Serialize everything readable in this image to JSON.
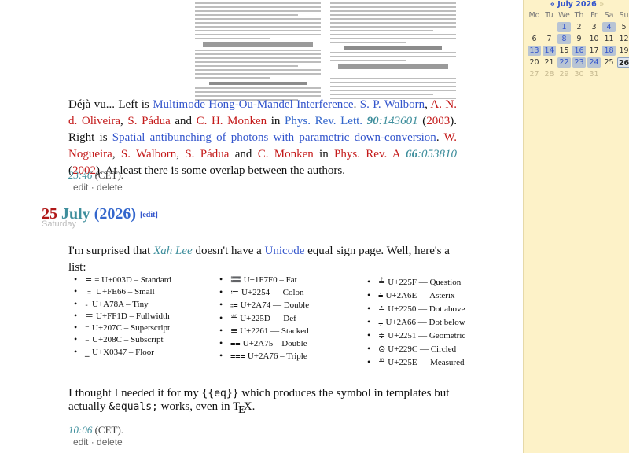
{
  "entry1": {
    "text_deja": "Déjà vu... Left is",
    "paper1_title": "Multimode Hong-Ou-Mandel Interference",
    "paper1_authors": [
      "S. P. Walborn",
      "A. N. d. Oliveira",
      "S. Pádua",
      "C. H. Monken"
    ],
    "paper1_journal": "Phys. Rev. Lett.",
    "paper1_volume": "90",
    "paper1_pages": "143601",
    "paper1_year": "2003",
    "text_right": "Right is",
    "paper2_title": "Spatial antibunching of photons with parametric down-conversion",
    "paper2_authors": [
      "W. Nogueira",
      "S. Walborn",
      "S. Pádua",
      "C. Monken"
    ],
    "paper2_journal": "Phys. Rev. A",
    "paper2_volume": "66",
    "paper2_pages": "053810",
    "paper2_year": "2002",
    "text_overlap": "At least there is some overlap between the authors.",
    "time": "23:46",
    "tz": "(CET).",
    "edit_label": "edit",
    "delete_label": "delete"
  },
  "day": {
    "number": "25",
    "month": "July",
    "year": "(2026)",
    "edit_link": "[edit]",
    "weekday": "Saturday"
  },
  "entry2": {
    "intro_pre": "I'm surprised that",
    "person": "Xah Lee",
    "intro_mid": "doesn't have a",
    "unicode_link": "Unicode",
    "intro_post": "equal sign page. Well, here's a list:",
    "col1": [
      {
        "sym": "=",
        "text": "= U+003D – Standard"
      },
      {
        "sym": "﹦",
        "text": "U+FE66 – Small"
      },
      {
        "sym": "꞊",
        "text": "U+A78A – Tiny"
      },
      {
        "sym": "＝",
        "text": "U+FF1D – Fullwidth"
      },
      {
        "sym": "⁼",
        "text": "U+207C – Superscript"
      },
      {
        "sym": "₌",
        "text": "U+208C – Subscript"
      },
      {
        "sym": "_",
        "text": "U+X0347 – Floor"
      }
    ],
    "col2": [
      {
        "sym": "🟰",
        "text": "U+1F7F0 – Fat"
      },
      {
        "sym": "≔",
        "text": "U+2254 — Colon"
      },
      {
        "sym": "⩴",
        "text": "U+2A74 — Double"
      },
      {
        "sym": "≝",
        "text": "U+225D — Def"
      },
      {
        "sym": "≡",
        "text": "U+2261 — Stacked"
      },
      {
        "sym": "⩵",
        "text": "U+2A75 – Double"
      },
      {
        "sym": "⩶",
        "text": "U+2A76 – Triple"
      }
    ],
    "col3": [
      {
        "sym": "≟",
        "text": "U+225F — Question"
      },
      {
        "sym": "⩮",
        "text": "U+2A6E — Asterix"
      },
      {
        "sym": "≐",
        "text": "U+2250 — Dot above"
      },
      {
        "sym": "⩦",
        "text": "U+2A66 — Dot below"
      },
      {
        "sym": "≑",
        "text": "U+2251 — Geometric"
      },
      {
        "sym": "⊜",
        "text": "U+229C — Circled"
      },
      {
        "sym": "≞",
        "text": "U+225E — Measured"
      }
    ],
    "outro_pre": "I thought I needed it for my",
    "outro_code1": "{{eq}}",
    "outro_mid": "which produces the symbol in templates but actually",
    "outro_code2": "&equals;",
    "outro_post": "works, even in",
    "tex_t": "T",
    "tex_e": "E",
    "tex_x": "X",
    "time": "10:06",
    "tz": "(CET).",
    "edit_label": "edit",
    "delete_label": "delete"
  },
  "calendar": {
    "prev": "«",
    "title": "July 2026",
    "next": "»",
    "weekdays": [
      "Mo",
      "Tu",
      "We",
      "Th",
      "Fr",
      "Sa",
      "Su"
    ],
    "rows": [
      [
        {
          "d": "",
          "t": "e"
        },
        {
          "d": "",
          "t": "e"
        },
        {
          "d": "1",
          "t": "hp"
        },
        {
          "d": "2",
          "t": "dd"
        },
        {
          "d": "3",
          "t": "dd"
        },
        {
          "d": "4",
          "t": "hp"
        },
        {
          "d": "5",
          "t": "dd"
        }
      ],
      [
        {
          "d": "6",
          "t": "dd"
        },
        {
          "d": "7",
          "t": "dd"
        },
        {
          "d": "8",
          "t": "hp"
        },
        {
          "d": "9",
          "t": "dd"
        },
        {
          "d": "10",
          "t": "dd"
        },
        {
          "d": "11",
          "t": "dd"
        },
        {
          "d": "12",
          "t": "dd"
        }
      ],
      [
        {
          "d": "13",
          "t": "hp"
        },
        {
          "d": "14",
          "t": "hp"
        },
        {
          "d": "15",
          "t": "dd"
        },
        {
          "d": "16",
          "t": "hp"
        },
        {
          "d": "17",
          "t": "dd"
        },
        {
          "d": "18",
          "t": "hp"
        },
        {
          "d": "19",
          "t": "dd"
        }
      ],
      [
        {
          "d": "20",
          "t": "dd"
        },
        {
          "d": "21",
          "t": "dd"
        },
        {
          "d": "22",
          "t": "hp"
        },
        {
          "d": "23",
          "t": "hp"
        },
        {
          "d": "24",
          "t": "hp"
        },
        {
          "d": "25",
          "t": "dd"
        },
        {
          "d": "26",
          "t": "today"
        }
      ],
      [
        {
          "d": "27",
          "t": "fut"
        },
        {
          "d": "28",
          "t": "fut"
        },
        {
          "d": "29",
          "t": "fut"
        },
        {
          "d": "30",
          "t": "fut"
        },
        {
          "d": "31",
          "t": "fut"
        },
        {
          "d": "",
          "t": "e"
        },
        {
          "d": "",
          "t": "e"
        }
      ]
    ]
  },
  "colors": {
    "link": "#3355cc",
    "author": "#c41a1a",
    "teal": "#3e8e9c",
    "sidebar_bg": "#fdf2c8",
    "calendar_highlight": "#b8c4d4"
  }
}
